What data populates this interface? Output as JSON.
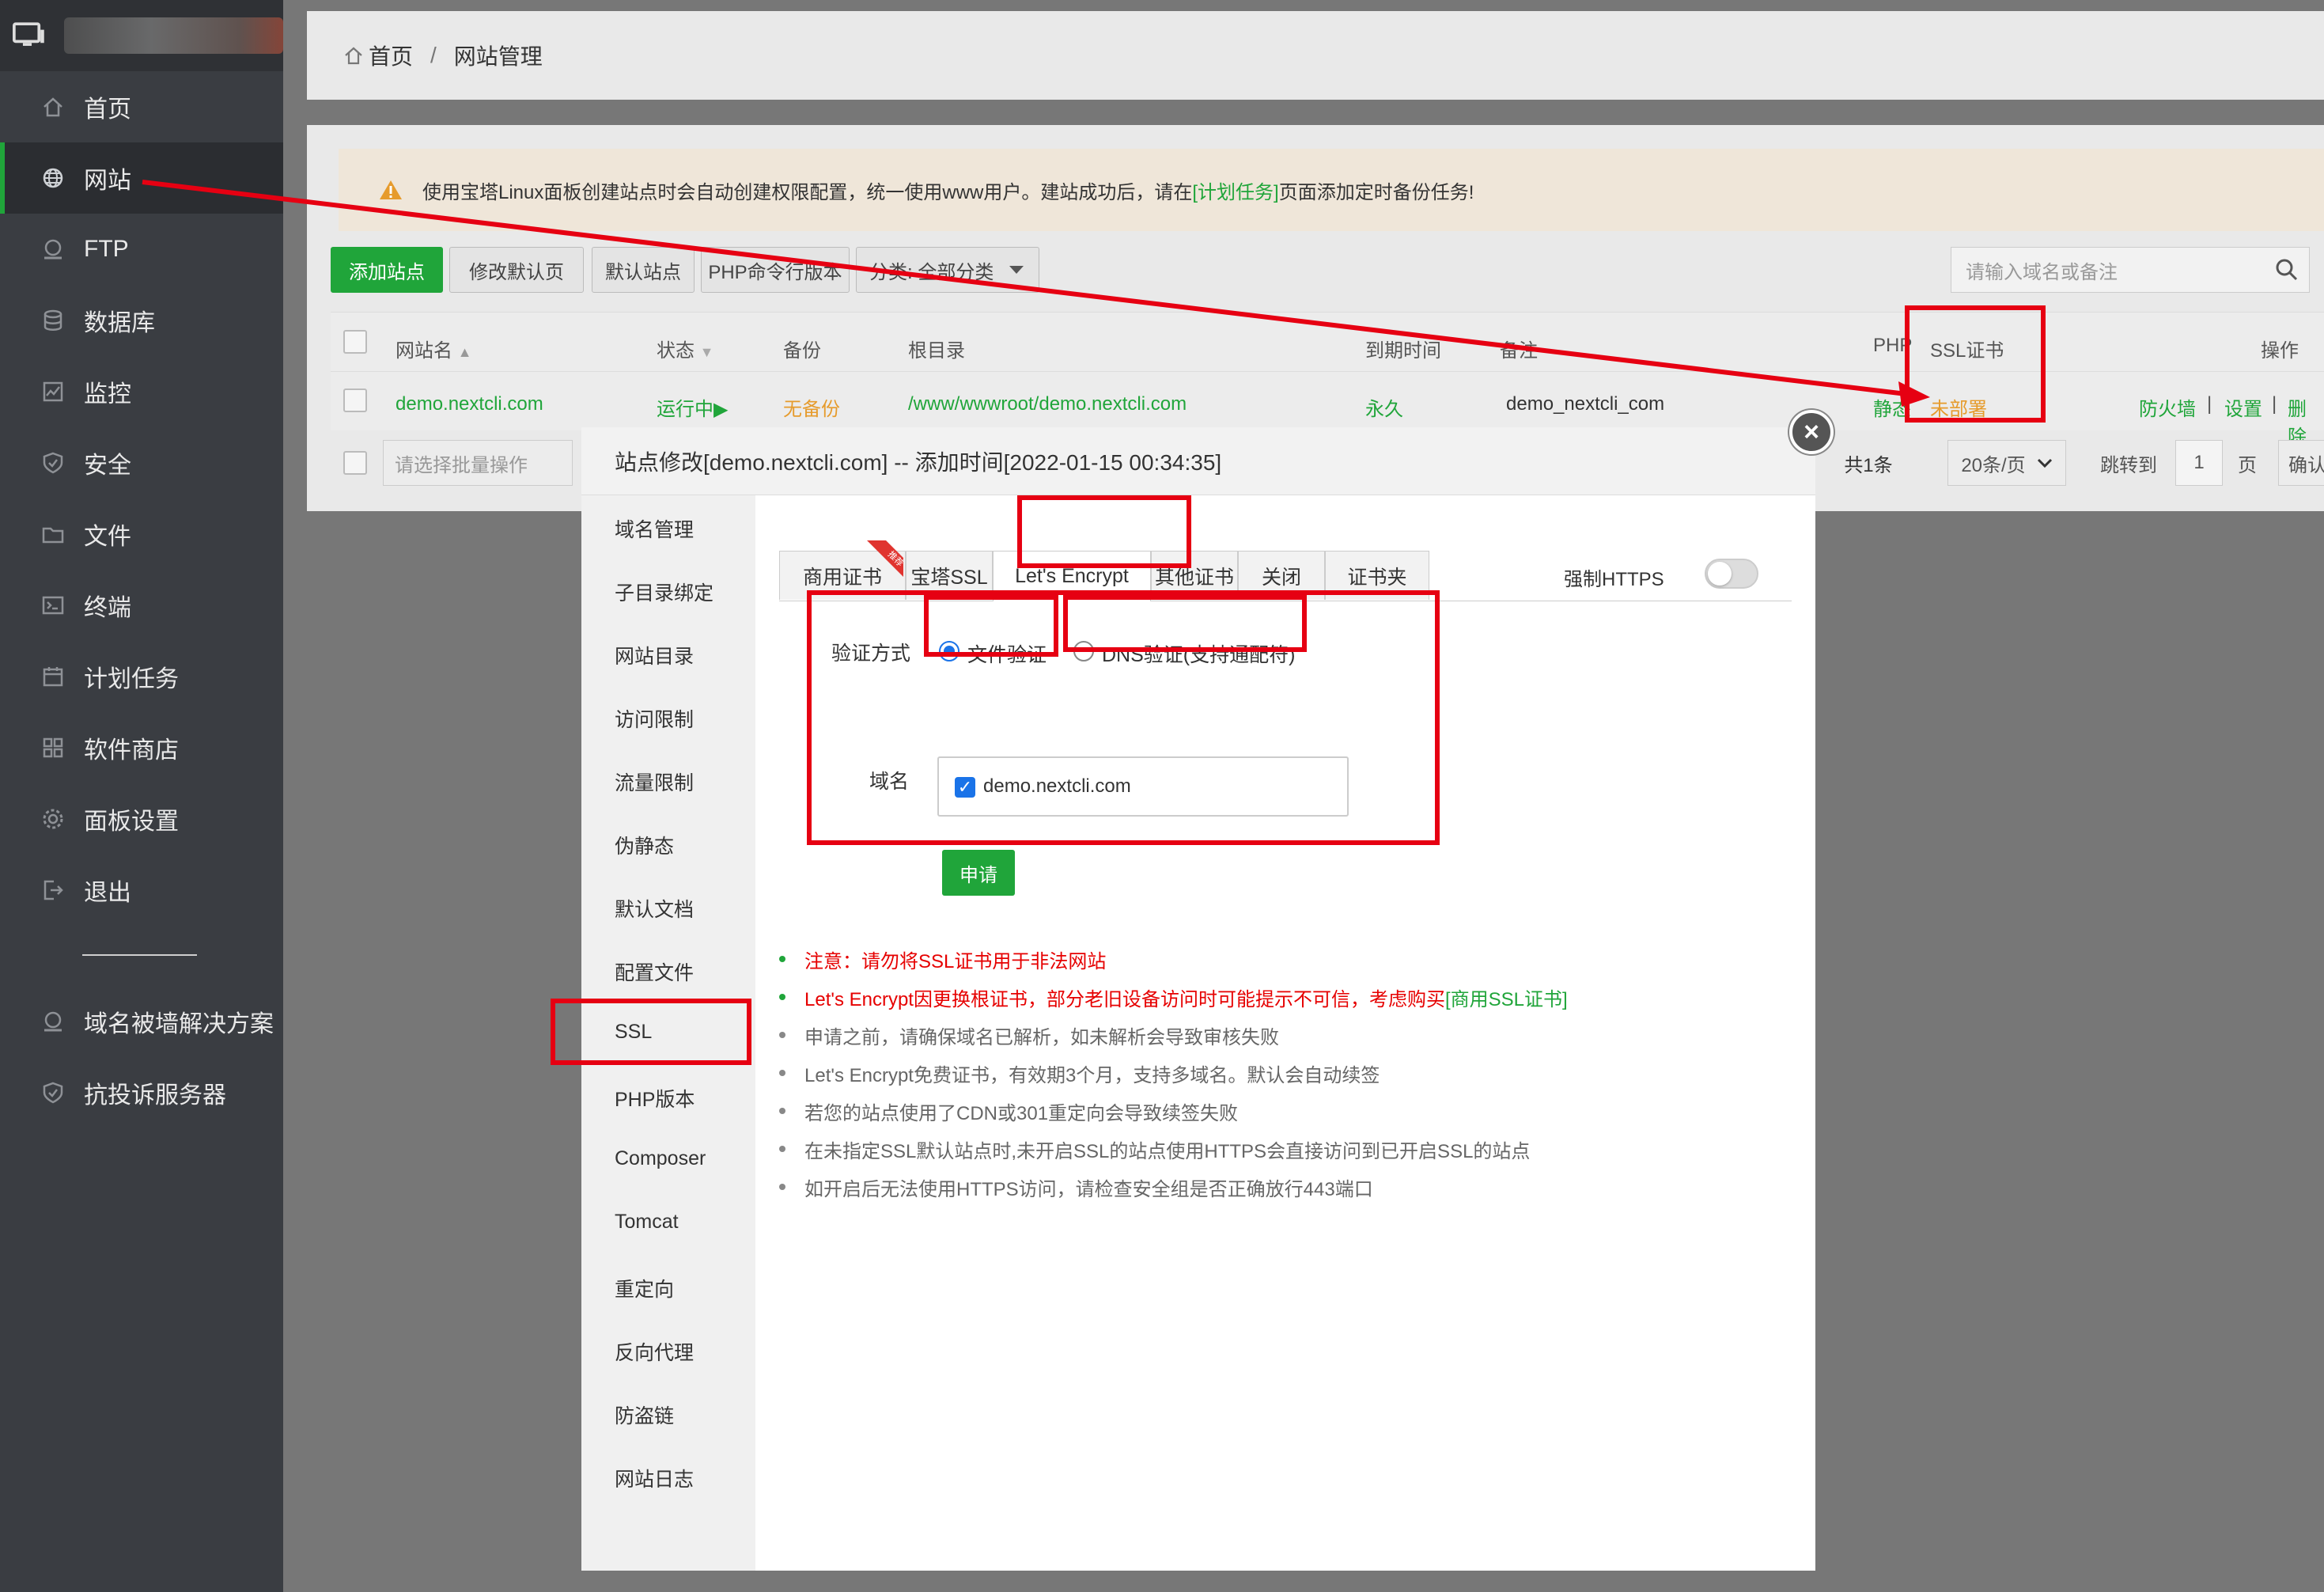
{
  "colors": {
    "accent": "#20a53a",
    "annotation": "#e60012",
    "warning": "#e69b2c",
    "radio_blue": "#1a73e8"
  },
  "sidebar": {
    "items": [
      {
        "label": "首页",
        "icon": "home-icon"
      },
      {
        "label": "网站",
        "icon": "globe-icon"
      },
      {
        "label": "FTP",
        "icon": "ftp-icon"
      },
      {
        "label": "数据库",
        "icon": "database-icon"
      },
      {
        "label": "监控",
        "icon": "monitor-icon"
      },
      {
        "label": "安全",
        "icon": "shield-icon"
      },
      {
        "label": "文件",
        "icon": "folder-icon"
      },
      {
        "label": "终端",
        "icon": "terminal-icon"
      },
      {
        "label": "计划任务",
        "icon": "calendar-icon"
      },
      {
        "label": "软件商店",
        "icon": "grid-icon"
      },
      {
        "label": "面板设置",
        "icon": "gear-icon"
      },
      {
        "label": "退出",
        "icon": "logout-icon"
      }
    ],
    "extra": [
      {
        "label": "域名被墙解决方案",
        "icon": "server-icon"
      },
      {
        "label": "抗投诉服务器",
        "icon": "shield-icon"
      }
    ]
  },
  "breadcrumb": {
    "home": "首页",
    "sep": "/",
    "current": "网站管理"
  },
  "notice": {
    "text_before": "使用宝塔Linux面板创建站点时会自动创建权限配置，统一使用www用户。建站成功后，请在",
    "link": "[计划任务]",
    "text_after": "页面添加定时备份任务!"
  },
  "toolbar": {
    "add_site": "添加站点",
    "edit_default": "修改默认页",
    "default_site": "默认站点",
    "php_cli": "PHP命令行版本",
    "category": "分类: 全部分类",
    "search_placeholder": "请输入域名或备注"
  },
  "table": {
    "headers": {
      "name": "网站名",
      "status": "状态",
      "backup": "备份",
      "root": "根目录",
      "expire": "到期时间",
      "remark": "备注",
      "php": "PHP",
      "ssl": "SSL证书",
      "ops": "操作"
    },
    "row": {
      "name": "demo.nextcli.com",
      "status": "运行中▶",
      "backup": "无备份",
      "root": "/www/wwwroot/demo.nextcli.com",
      "expire": "永久",
      "remark": "demo_nextcli_com",
      "php": "静态",
      "ssl": "未部署",
      "op_firewall": "防火墙",
      "op_sep": "|",
      "op_settings": "设置",
      "op_delete": "删除"
    }
  },
  "footer": {
    "batch_placeholder": "请选择批量操作",
    "total": "共1条",
    "per_page": "20条/页",
    "jump_to": "跳转到",
    "page_num": "1",
    "page_unit": "页",
    "confirm": "确认"
  },
  "modal": {
    "title": "站点修改[demo.nextcli.com] -- 添加时间[2022-01-15 00:34:35]",
    "close": "×",
    "nav": [
      "域名管理",
      "子目录绑定",
      "网站目录",
      "访问限制",
      "流量限制",
      "伪静态",
      "默认文档",
      "配置文件",
      "SSL",
      "PHP版本",
      "Composer",
      "Tomcat",
      "重定向",
      "反向代理",
      "防盗链",
      "网站日志"
    ],
    "tabs": [
      "商用证书",
      "宝塔SSL",
      "Let's Encrypt",
      "其他证书",
      "关闭",
      "证书夹"
    ],
    "ribbon": "推荐",
    "force_https": "强制HTTPS",
    "verify_label": "验证方式",
    "file_verify": "文件验证",
    "dns_verify": "DNS验证(支持通配符)",
    "domain_label": "域名",
    "domain_value": "demo.nextcli.com",
    "apply": "申请",
    "tips": [
      {
        "text": "注意：请勿将SSL证书用于非法网站",
        "warn": true
      },
      {
        "text": "Let's Encrypt因更换根证书，部分老旧设备访问时可能提示不可信，考虑购买",
        "link": "[商用SSL证书]",
        "warn": true
      },
      {
        "text": "申请之前，请确保域名已解析，如未解析会导致审核失败"
      },
      {
        "text": "Let's Encrypt免费证书，有效期3个月，支持多域名。默认会自动续签"
      },
      {
        "text": "若您的站点使用了CDN或301重定向会导致续签失败"
      },
      {
        "text": "在未指定SSL默认站点时,未开启SSL的站点使用HTTPS会直接访问到已开启SSL的站点"
      },
      {
        "text": "如开启后无法使用HTTPS访问，请检查安全组是否正确放行443端口"
      }
    ]
  }
}
